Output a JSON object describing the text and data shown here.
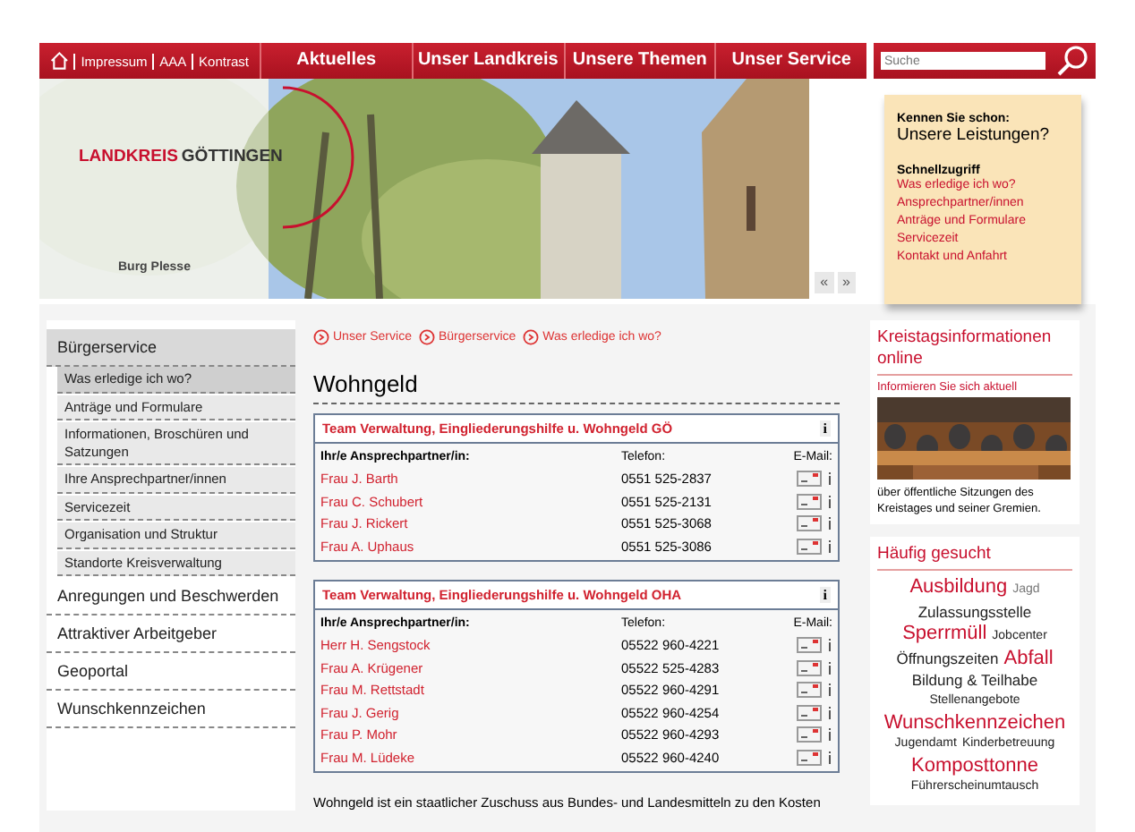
{
  "top_links": [
    "Impressum",
    "AAA",
    "Kontrast"
  ],
  "nav": [
    "Aktuelles",
    "Unser Landkreis",
    "Unsere Themen",
    "Unser Service"
  ],
  "search": {
    "placeholder": "Suche"
  },
  "hero": {
    "logo_part1": "LANDKREIS",
    "logo_part2": "GÖTTINGEN",
    "caption": "Burg Plesse",
    "prev": "«",
    "next": "»"
  },
  "note": {
    "intro": "Kennen Sie schon:",
    "title": "Unsere Leistungen?",
    "heading": "Schnellzugriff",
    "links": [
      "Was erledige ich wo?",
      "Ansprechpartner/innen",
      "Anträge und Formulare",
      "Servicezeit",
      "Kontakt und Anfahrt"
    ]
  },
  "sidebar": {
    "items": [
      {
        "label": "Bürgerservice",
        "expanded": true,
        "children": [
          {
            "label": "Was erledige ich wo?",
            "selected": true
          },
          {
            "label": "Anträge und Formulare",
            "selected": false
          },
          {
            "label": "Informationen, Broschüren und Satzungen",
            "selected": false
          },
          {
            "label": "Ihre Ansprechpartner/innen",
            "selected": false
          },
          {
            "label": "Servicezeit",
            "selected": false
          },
          {
            "label": "Organisation und Struktur",
            "selected": false
          },
          {
            "label": "Standorte Kreisverwaltung",
            "selected": false
          }
        ]
      },
      {
        "label": "Anregungen und Beschwerden",
        "expanded": false
      },
      {
        "label": "Attraktiver Arbeitgeber",
        "expanded": false
      },
      {
        "label": "Geoportal",
        "expanded": false
      },
      {
        "label": "Wunschkennzeichen",
        "expanded": false
      }
    ]
  },
  "breadcrumb": [
    "Unser Service",
    "Bürgerservice",
    "Was erledige ich wo?"
  ],
  "heading": "Wohngeld",
  "teams": [
    {
      "title": "Team Verwaltung, Eingliederungshilfe u. Wohngeld GÖ",
      "info": "i",
      "col_person": "Ihr/e Ansprechpartner/in:",
      "col_phone": "Telefon:",
      "col_mail": "E-Mail:",
      "rows": [
        {
          "name": "Frau J. Barth",
          "phone": "0551 525-2837"
        },
        {
          "name": "Frau C. Schubert",
          "phone": "0551 525-2131"
        },
        {
          "name": "Frau J. Rickert",
          "phone": "0551 525-3068"
        },
        {
          "name": "Frau A. Uphaus",
          "phone": "0551 525-3086"
        }
      ]
    },
    {
      "title": "Team Verwaltung, Eingliederungshilfe u. Wohngeld OHA",
      "info": "i",
      "col_person": "Ihr/e Ansprechpartner/in:",
      "col_phone": "Telefon:",
      "col_mail": "E-Mail:",
      "rows": [
        {
          "name": "Herr H. Sengstock",
          "phone": "05522 960-4221"
        },
        {
          "name": "Frau A. Krügener",
          "phone": "05522 525-4283"
        },
        {
          "name": "Frau M. Rettstadt",
          "phone": "05522 960-4291"
        },
        {
          "name": "Frau J. Gerig",
          "phone": "05522 960-4254"
        },
        {
          "name": "Frau P. Mohr",
          "phone": "05522 960-4293"
        },
        {
          "name": "Frau M. Lüdeke",
          "phone": "05522 960-4240"
        }
      ]
    }
  ],
  "intro_text": "Wohngeld ist ein staatlicher Zuschuss aus Bundes- und Landesmitteln zu den Kosten",
  "kreistag": {
    "title": "Kreistagsinformationen online",
    "subtitle": "Informieren Sie sich aktuell",
    "text": "über öffentliche Sitzungen des Kreistages und seiner Gremien."
  },
  "popular": {
    "title": "Häufig gesucht",
    "lines": [
      [
        {
          "text": "Ausbildung",
          "kind": "big"
        },
        {
          "text": "Jagd",
          "kind": "faint"
        }
      ],
      [
        {
          "text": "Zulassungsstelle",
          "kind": "mid"
        }
      ],
      [
        {
          "text": "Sperrmüll",
          "kind": "big"
        },
        {
          "text": "Jobcenter",
          "kind": "small"
        }
      ],
      [
        {
          "text": "Öffnungszeiten",
          "kind": "mid"
        },
        {
          "text": "Abfall",
          "kind": "big"
        }
      ],
      [
        {
          "text": "Bildung & Teilhabe",
          "kind": "mid"
        }
      ],
      [
        {
          "text": "Stellenangebote",
          "kind": "small"
        }
      ],
      [
        {
          "text": "Wunschkennzeichen",
          "kind": "big"
        }
      ],
      [
        {
          "text": "Jugendamt",
          "kind": "small"
        },
        {
          "text": "Kinderbetreuung",
          "kind": "small"
        }
      ],
      [
        {
          "text": "Komposttonne",
          "kind": "big"
        }
      ],
      [
        {
          "text": "Führerscheinumtausch",
          "kind": "small"
        }
      ]
    ]
  }
}
